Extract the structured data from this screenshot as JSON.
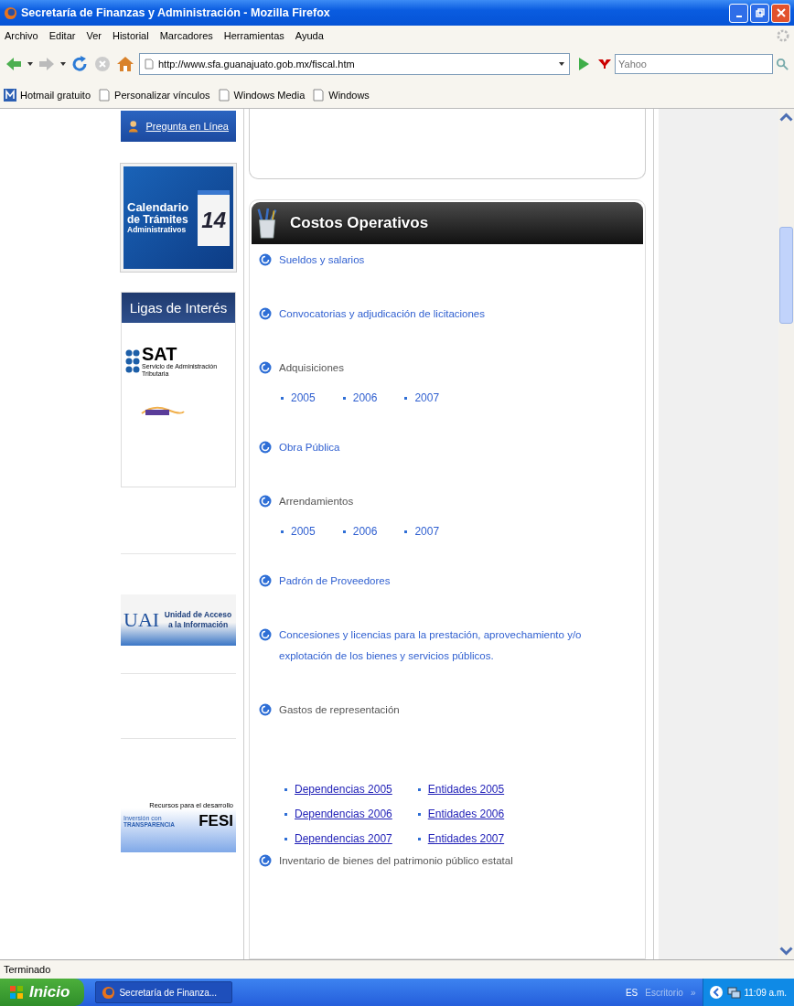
{
  "window": {
    "title": "Secretaría de Finanzas y Administración - Mozilla Firefox"
  },
  "menu": [
    "Archivo",
    "Editar",
    "Ver",
    "Historial",
    "Marcadores",
    "Herramientas",
    "Ayuda"
  ],
  "toolbar": {
    "url": "http://www.sfa.guanajuato.gob.mx/fiscal.htm",
    "search_placeholder": "Yahoo"
  },
  "bookmarks": [
    {
      "label": "Hotmail gratuito",
      "kind": "hotmail"
    },
    {
      "label": "Personalizar vínculos",
      "kind": "page"
    },
    {
      "label": "Windows Media",
      "kind": "page"
    },
    {
      "label": "Windows",
      "kind": "page"
    }
  ],
  "sidebar": {
    "ask_button": "Pregunta en Línea",
    "calendar": {
      "title": "Calendario",
      "subtitle": "de Trámites",
      "caption": "Administrativos",
      "day": "14"
    },
    "links_heading": "Ligas de Interés",
    "sat": {
      "name": "SAT",
      "subtitle": "Servicio de Administración Tributaria"
    },
    "uai": {
      "abbr": "UAI",
      "text": "Unidad de Acceso a la Información"
    },
    "fesi": {
      "tagline": "Recursos para el desarrollo",
      "brand_1": "Inversión con",
      "brand_2": "TRANSPARENCIA",
      "name": "FESI"
    }
  },
  "section_title": "Costos Operativos",
  "items": [
    {
      "label": "Sueldos y salarios",
      "kind": "link"
    },
    {
      "label": "Convocatorias y adjudicación de licitaciones",
      "kind": "link"
    },
    {
      "label": "Adquisiciones",
      "kind": "heading",
      "sublinks": [
        "2005",
        "2006",
        "2007"
      ]
    },
    {
      "label": "Obra Pública",
      "kind": "link"
    },
    {
      "label": "Arrendamientos",
      "kind": "heading",
      "sublinks": [
        "2005",
        "2006",
        "2007"
      ]
    },
    {
      "label": "Padrón de Proveedores",
      "kind": "link"
    },
    {
      "label": "Concesiones y licencias para la prestación, aprovechamiento y/o explotación de los bienes y servicios públicos.",
      "kind": "link"
    },
    {
      "label": "Gastos de representación",
      "kind": "heading",
      "sublink_rows": [
        [
          "Dependencias 2005",
          "Entidades 2005"
        ],
        [
          "Dependencias 2006",
          "Entidades 2006"
        ],
        [
          "Dependencias 2007",
          "Entidades 2007"
        ]
      ]
    },
    {
      "label": "Inventario de bienes del patrimonio público estatal",
      "kind": "heading"
    }
  ],
  "status_bar": "Terminado",
  "taskbar": {
    "start": "Inicio",
    "task": "Secretaría de Finanza...",
    "language": "ES",
    "desktop": "Escritorio",
    "chevron": "»",
    "clock": "11:09 a.m."
  }
}
